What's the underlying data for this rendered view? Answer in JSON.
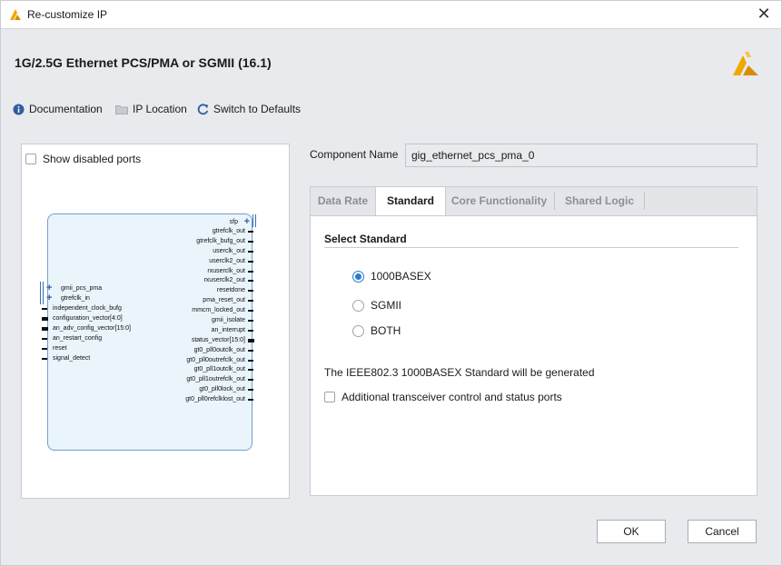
{
  "window": {
    "title": "Re-customize IP"
  },
  "header": {
    "ip_title": "1G/2.5G Ethernet PCS/PMA or SGMII (16.1)"
  },
  "toolbar": {
    "documentation": "Documentation",
    "ip_location": "IP Location",
    "switch_defaults": "Switch to Defaults"
  },
  "left_panel": {
    "show_disabled_ports": "Show disabled ports",
    "show_disabled_checked": false,
    "symbol": {
      "left_ports": [
        "gmii_pcs_pma",
        "gtrefclk_in",
        "independent_clock_bufg",
        "configuration_vector[4:0]",
        "an_adv_config_vector[15:0]",
        "an_restart_config",
        "reset",
        "signal_detect"
      ],
      "right_ports": [
        "sfp",
        "gtrefclk_out",
        "gtrefclk_bufg_out",
        "userclk_out",
        "userclk2_out",
        "rxuserclk_out",
        "rxuserclk2_out",
        "resetdone",
        "pma_reset_out",
        "mmcm_locked_out",
        "gmii_isolate",
        "an_interrupt",
        "status_vector[15:0]",
        "gt0_pll0outclk_out",
        "gt0_pll0outrefclk_out",
        "gt0_pll1outclk_out",
        "gt0_pll1outrefclk_out",
        "gt0_pll0lock_out",
        "gt0_pll0refclklost_out"
      ]
    }
  },
  "component": {
    "label": "Component Name",
    "value": "gig_ethernet_pcs_pma_0"
  },
  "tabs": [
    {
      "label": "Data Rate",
      "active": false
    },
    {
      "label": "Standard",
      "active": true
    },
    {
      "label": "Core Functionality",
      "active": false
    },
    {
      "label": "Shared Logic",
      "active": false
    }
  ],
  "standard": {
    "section_title": "Select Standard",
    "options": [
      "1000BASEX",
      "SGMII",
      "BOTH"
    ],
    "selected": "1000BASEX",
    "info_text": "The IEEE802.3 1000BASEX Standard will be generated",
    "transceiver_checkbox": "Additional transceiver control and status ports",
    "transceiver_checked": false
  },
  "buttons": {
    "ok": "OK",
    "cancel": "Cancel"
  },
  "colors": {
    "accent": "#2b7bd0",
    "logo": "#f0a800",
    "panel_bg": "#e8eaee"
  }
}
